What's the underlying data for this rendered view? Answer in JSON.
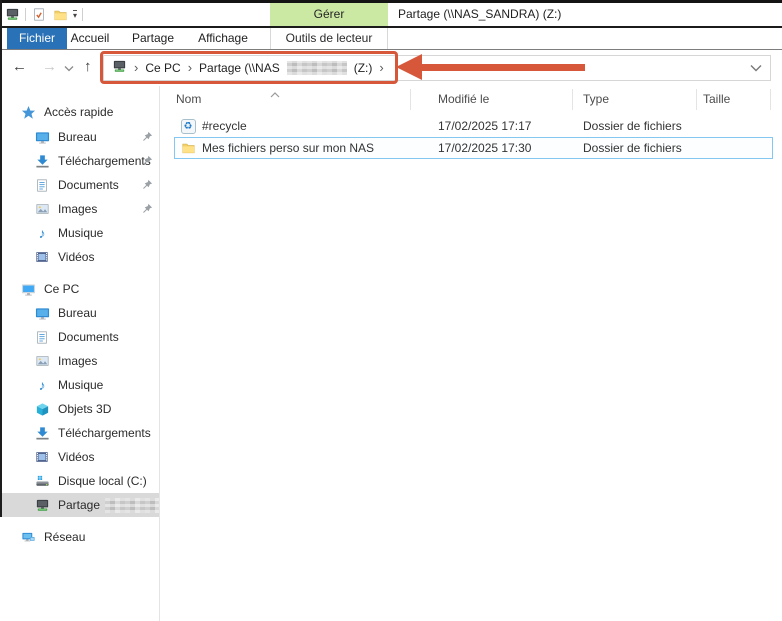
{
  "titlebar": {
    "window_title": "Partage (\\\\NAS_SANDRA) (Z:)",
    "manage_label": "Gérer"
  },
  "ribbon": {
    "file_tab": "Fichier",
    "home_tab": "Accueil",
    "share_tab": "Partage",
    "view_tab": "Affichage",
    "drive_tools_tab": "Outils de lecteur"
  },
  "address": {
    "crumb_this_pc": "Ce PC",
    "crumb_share_prefix": "Partage (\\\\NAS",
    "crumb_share_suffix": "(Z:)",
    "separator": "›"
  },
  "icons": {
    "back": "←",
    "forward": "→",
    "up": "↑",
    "recycle_glyph": "♻",
    "music_glyph": "♪"
  },
  "list": {
    "columns": {
      "name": "Nom",
      "modified": "Modifié le",
      "type": "Type",
      "size": "Taille"
    },
    "files": [
      {
        "name": "#recycle",
        "modified": "17/02/2025 17:17",
        "type": "Dossier de fichiers",
        "size": ""
      },
      {
        "name": "Mes fichiers perso sur mon NAS",
        "modified": "17/02/2025 17:30",
        "type": "Dossier de fichiers",
        "size": ""
      }
    ]
  },
  "sidebar": {
    "quick_access_label": "Accès rapide",
    "qa": [
      {
        "label": "Bureau"
      },
      {
        "label": "Téléchargements"
      },
      {
        "label": "Documents"
      },
      {
        "label": "Images"
      },
      {
        "label": "Musique"
      },
      {
        "label": "Vidéos"
      }
    ],
    "this_pc_label": "Ce PC",
    "pc": [
      {
        "label": "Bureau"
      },
      {
        "label": "Documents"
      },
      {
        "label": "Images"
      },
      {
        "label": "Musique"
      },
      {
        "label": "Objets 3D"
      },
      {
        "label": "Téléchargements"
      },
      {
        "label": "Vidéos"
      },
      {
        "label": "Disque local (C:)"
      },
      {
        "label": "Partage"
      }
    ],
    "network_label": "Réseau"
  },
  "colors": {
    "file_tab_blue": "#2a72b8",
    "manage_green": "#cbe9a3",
    "annotation_orange": "#d6573a",
    "selection_border_blue": "#84c7f0",
    "sidebar_selected_gray": "#d9d9d9"
  }
}
